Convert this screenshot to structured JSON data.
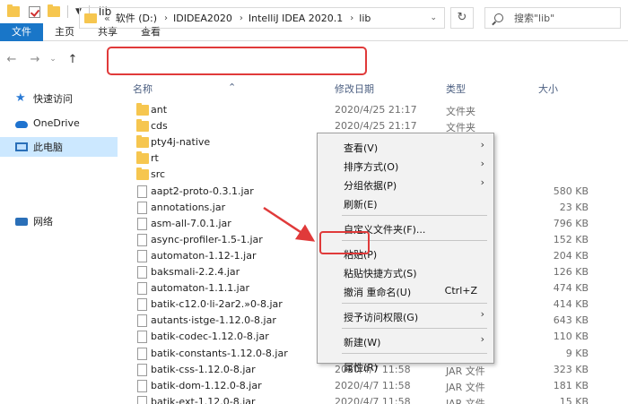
{
  "window": {
    "title": "lib"
  },
  "ribbon": {
    "tabs": [
      "文件",
      "主页",
      "共享",
      "查看"
    ]
  },
  "address": {
    "chevron": "«",
    "crumbs": [
      "软件 (D:)",
      "IDIDEA2020",
      "IntelliJ IDEA 2020.1",
      "lib"
    ]
  },
  "search": {
    "placeholder": "搜索\"lib\""
  },
  "sidebar": {
    "items": [
      {
        "label": "快速访问",
        "icon": "star-icon"
      },
      {
        "label": "OneDrive",
        "icon": "cloud-icon"
      },
      {
        "label": "此电脑",
        "icon": "computer-icon",
        "selected": true
      },
      {
        "label": "网络",
        "icon": "network-icon"
      }
    ]
  },
  "columns": {
    "name": "名称",
    "date": "修改日期",
    "type": "类型",
    "size": "大小"
  },
  "files": [
    {
      "name": "ant",
      "kind": "folder",
      "date": "2020/4/25 21:17",
      "type": "文件夹",
      "size": ""
    },
    {
      "name": "cds",
      "kind": "folder",
      "date": "2020/4/25 21:17",
      "type": "文件夹",
      "size": ""
    },
    {
      "name": "pty4j-native",
      "kind": "folder",
      "date": "",
      "type": "",
      "size": ""
    },
    {
      "name": "rt",
      "kind": "folder",
      "date": "",
      "type": "",
      "size": ""
    },
    {
      "name": "src",
      "kind": "folder",
      "date": "",
      "type": "",
      "size": ""
    },
    {
      "name": "aapt2-proto-0.3.1.jar",
      "kind": "jar",
      "date": "",
      "type": "",
      "size": "580 KB"
    },
    {
      "name": "annotations.jar",
      "kind": "jar",
      "date": "",
      "type": "",
      "size": "23 KB"
    },
    {
      "name": "asm-all-7.0.1.jar",
      "kind": "jar",
      "date": "",
      "type": "",
      "size": "796 KB"
    },
    {
      "name": "async-profiler-1.5-1.jar",
      "kind": "jar",
      "date": "",
      "type": "",
      "size": "152 KB"
    },
    {
      "name": "automaton-1.12-1.jar",
      "kind": "jar",
      "date": "",
      "type": "",
      "size": "204 KB"
    },
    {
      "name": "baksmali-2.2.4.jar",
      "kind": "jar",
      "date": "",
      "type": "",
      "size": "126 KB"
    },
    {
      "name": "automaton-1.1.1.jar",
      "kind": "jar",
      "date": "",
      "type": "",
      "size": "474 KB"
    },
    {
      "name": "batik-c12.0·li-2ar2.»0-8.jar",
      "kind": "jar",
      "date": "",
      "type": "",
      "size": "414 KB"
    },
    {
      "name": "autants·istge-1.12.0-8.jar",
      "kind": "jar",
      "date": "",
      "type": "",
      "size": "643 KB"
    },
    {
      "name": "batik-codec-1.12.0-8.jar",
      "kind": "jar",
      "date": "",
      "type": "",
      "size": "110 KB"
    },
    {
      "name": "batik-constants-1.12.0-8.jar",
      "kind": "jar",
      "date": "",
      "type": "",
      "size": "9 KB"
    },
    {
      "name": "batik-css-1.12.0-8.jar",
      "kind": "jar",
      "date": "2020/4/7 11:58",
      "type": "JAR 文件",
      "size": "323 KB"
    },
    {
      "name": "batik-dom-1.12.0-8.jar",
      "kind": "jar",
      "date": "2020/4/7 11:58",
      "type": "JAR 文件",
      "size": "181 KB"
    },
    {
      "name": "batik-ext-1.12.0-8.jar",
      "kind": "jar",
      "date": "2020/4/7 11:58",
      "type": "JAR 文件",
      "size": "15 KB"
    }
  ],
  "context_menu": {
    "items": [
      {
        "label": "查看(V)",
        "submenu": true
      },
      {
        "label": "排序方式(O)",
        "submenu": true
      },
      {
        "label": "分组依据(P)",
        "submenu": true
      },
      {
        "label": "刷新(E)"
      },
      {
        "separator": true
      },
      {
        "label": "自定义文件夹(F)..."
      },
      {
        "separator": true
      },
      {
        "label": "粘贴(P)",
        "highlighted": true
      },
      {
        "label": "粘贴快捷方式(S)"
      },
      {
        "label": "撤消 重命名(U)",
        "shortcut": "Ctrl+Z"
      },
      {
        "separator": true
      },
      {
        "label": "授予访问权限(G)",
        "submenu": true
      },
      {
        "separator": true
      },
      {
        "label": "新建(W)",
        "submenu": true
      },
      {
        "separator": true
      },
      {
        "label": "属性(R)"
      }
    ]
  },
  "colors": {
    "accent": "#1976c8",
    "annotation": "#e03a3a",
    "folder": "#f6c64f",
    "selection": "#cce8ff"
  }
}
